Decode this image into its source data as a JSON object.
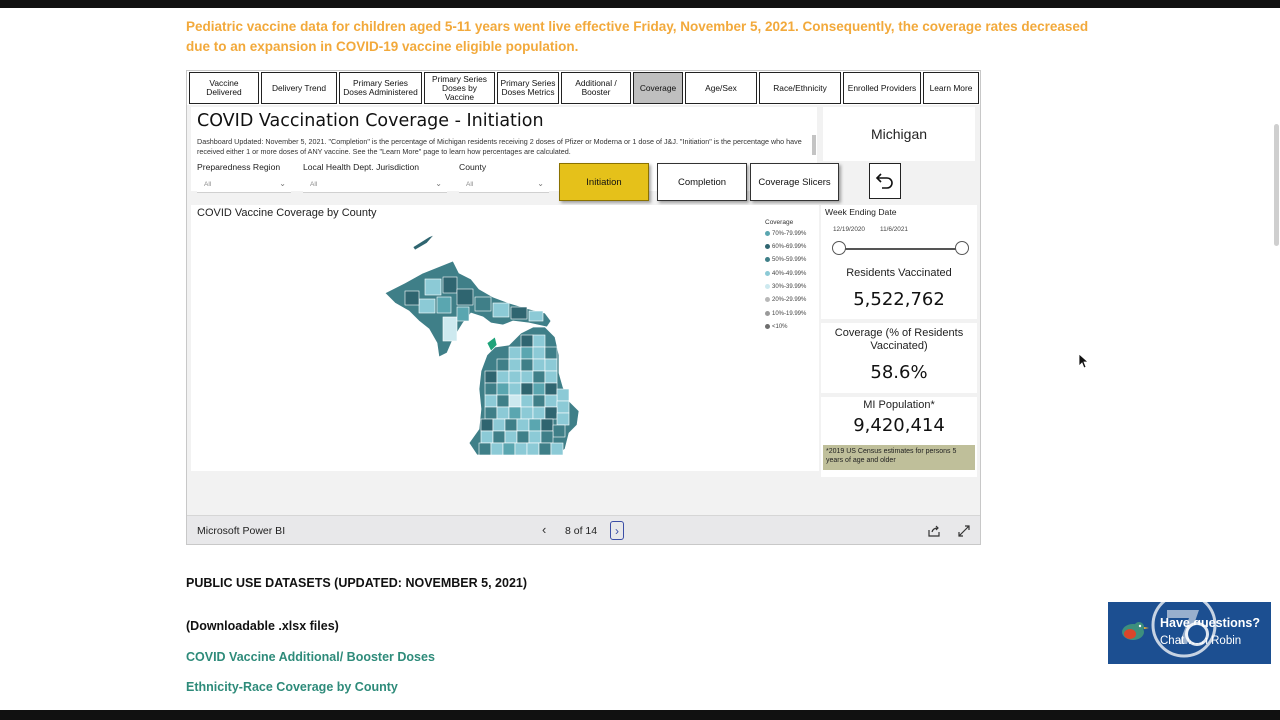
{
  "notice": "Pediatric vaccine data for children aged 5-11 years went live effective Friday, November 5, 2021. Consequently, the coverage rates decreased due to an expansion in COVID-19 vaccine eligible population.",
  "tabs": [
    {
      "label": "Vaccine Delivered"
    },
    {
      "label": "Delivery Trend"
    },
    {
      "label": "Primary Series Doses Administered"
    },
    {
      "label": "Primary Series Doses by Vaccine"
    },
    {
      "label": "Primary Series Doses Metrics"
    },
    {
      "label": "Additional / Booster"
    },
    {
      "label": "Coverage"
    },
    {
      "label": "Age/Sex"
    },
    {
      "label": "Race/Ethnicity"
    },
    {
      "label": "Enrolled Providers"
    },
    {
      "label": "Learn More"
    }
  ],
  "active_tab": "Coverage",
  "dashboard": {
    "title": "COVID Vaccination Coverage - Initiation",
    "description": "Dashboard Updated: November 5, 2021. \"Completion\" is the percentage of Michigan residents receiving 2 doses of Pfizer or Moderna or 1 dose of J&J. \"Initiation\" is the percentage who have received either 1 or more doses of ANY vaccine. See the \"Learn More\" page to learn how percentages are calculated.",
    "region_name": "Michigan"
  },
  "filters": [
    {
      "label": "Preparedness Region",
      "value": "All"
    },
    {
      "label": "Local Health Dept. Jurisdiction",
      "value": "All"
    },
    {
      "label": "County",
      "value": "All"
    }
  ],
  "buttons": {
    "initiation": "Initiation",
    "completion": "Completion",
    "slicers": "Coverage Slicers"
  },
  "map": {
    "title": "COVID Vaccine Coverage by County",
    "legend_title": "Coverage",
    "legend": [
      {
        "label": "70%-79.99%",
        "color": "#5aa6b0"
      },
      {
        "label": "60%-69.99%",
        "color": "#2f6570"
      },
      {
        "label": "50%-59.99%",
        "color": "#3f7f88"
      },
      {
        "label": "40%-49.99%",
        "color": "#8ccad6"
      },
      {
        "label": "30%-39.99%",
        "color": "#cde9ef"
      },
      {
        "label": "20%-29.99%",
        "color": "#b8b8b8"
      },
      {
        "label": "10%-19.99%",
        "color": "#9a9a9a"
      },
      {
        "label": "<10%",
        "color": "#6e6e6e"
      }
    ]
  },
  "slider": {
    "label": "Week Ending Date",
    "start": "12/19/2020",
    "end": "11/6/2021"
  },
  "kpis": {
    "residents_label": "Residents Vaccinated",
    "residents_value": "5,522,762",
    "coverage_label": "Coverage (% of Residents Vaccinated)",
    "coverage_value": "58.6%",
    "population_label": "MI Population*",
    "population_value": "9,420,414",
    "census_note": "*2019 US Census estimates for persons 5 years of age and older"
  },
  "footer": {
    "brand": "Microsoft Power BI",
    "page": "8 of 14"
  },
  "datasets_heading": "PUBLIC USE DATASETS (UPDATED: NOVEMBER 5, 2021)",
  "xlsx_note": "(Downloadable .xlsx files)",
  "links": [
    {
      "label": "COVID Vaccine Additional/ Booster Doses"
    },
    {
      "label": "Ethnicity-Race Coverage by County"
    }
  ],
  "chat": {
    "title": "Have questions?",
    "subtitle": "Chat with Robin"
  },
  "colors": {
    "notice": "#f2a93b",
    "link": "#2e8b7a",
    "primary_button": "#e5c11a",
    "chat_bg": "#1c4f91"
  }
}
